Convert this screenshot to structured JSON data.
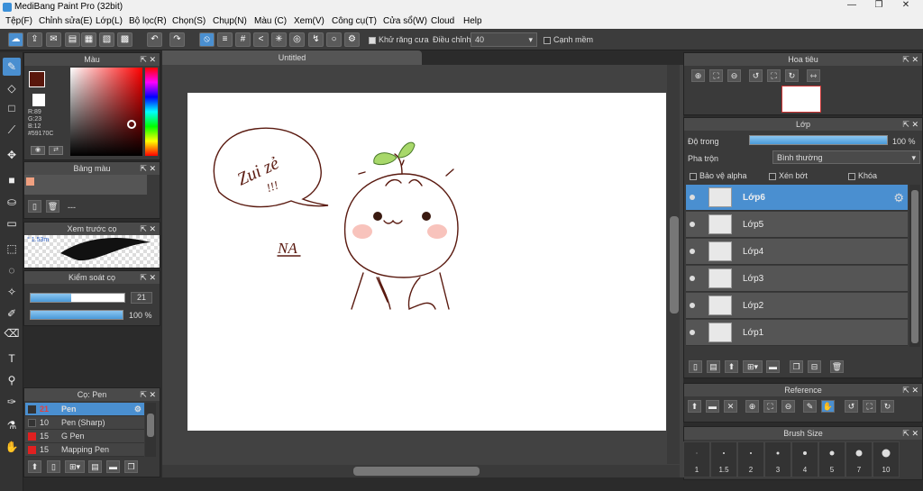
{
  "window": {
    "title": "MediBang Paint Pro (32bit)",
    "min": "—",
    "max": "❐",
    "close": "✕"
  },
  "menu": [
    "Tệp(F)",
    "Chỉnh sửa(E)",
    "Lớp(L)",
    "Bộ lọc(R)",
    "Chọn(S)",
    "Chụp(N)",
    "Màu (C)",
    "Xem(V)",
    "Công cụ(T)",
    "Cửa sổ(W)",
    "Cloud",
    "Help"
  ],
  "toolbar": {
    "antialias": "Khử răng cưa",
    "adjust": "Điều chỉnh",
    "adjust_value": "40",
    "edge": "Cạnh mềm"
  },
  "color_panel": {
    "title": "Màu",
    "r": "R:89",
    "g": "G:23",
    "b": "B:12",
    "hex": "#59170C",
    "fg": "#59170C"
  },
  "palette_panel": {
    "title": "Bảng màu",
    "swatch": "#f0a080",
    "dash": "---"
  },
  "preview_panel": {
    "title": "Xem trước cọ",
    "size": "1.53m"
  },
  "control_panel": {
    "title": "Kiểm soát cọ",
    "size": "21",
    "opacity": "100 %",
    "size_frac": 0.43,
    "opacity_frac": 1.0
  },
  "brush_panel": {
    "title": "Cọ: Pen",
    "brushes": [
      {
        "num": "21",
        "name": "Pen",
        "color": "#333"
      },
      {
        "num": "10",
        "name": "Pen (Sharp)",
        "color": "#333"
      },
      {
        "num": "15",
        "name": "G Pen",
        "color": "#e02020"
      },
      {
        "num": "15",
        "name": "Mapping Pen",
        "color": "#e02020"
      }
    ]
  },
  "canvas": {
    "tab": "Untitled",
    "speech1": "Zui zẻ",
    "speech2": "!!!",
    "sign": "NA"
  },
  "nav_panel": {
    "title": "Hoa tiêu"
  },
  "layer_panel": {
    "title": "Lớp",
    "opacity_label": "Độ trong",
    "opacity_value": "100 %",
    "blend_label": "Pha trộn",
    "blend_value": "Bình thường",
    "protect": "Bảo vệ alpha",
    "clip": "Xén bớt",
    "lock": "Khóa",
    "layers": [
      "Lớp6",
      "Lớp5",
      "Lớp4",
      "Lớp3",
      "Lớp2",
      "Lớp1"
    ]
  },
  "reference_panel": {
    "title": "Reference"
  },
  "brushsize_panel": {
    "title": "Brush Size",
    "sizes": [
      "1",
      "1.5",
      "2",
      "3",
      "4",
      "5",
      "7",
      "10"
    ]
  }
}
